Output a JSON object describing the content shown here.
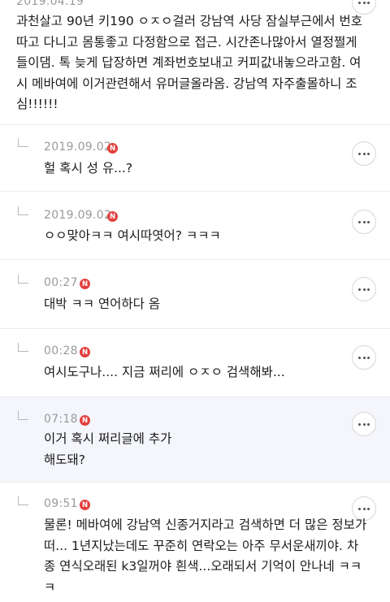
{
  "post": {
    "date": "2019.04.19",
    "text": "과천살고 90년 키190 ㅇㅈㅇ걸러 강남역 사당 잠실부근에서 번호따고 다니고 몸통좋고 다정함으로 접근. 시간존나많아서 열정쩔게 들이댐. 톡 늦게 답장하면 계좌번호보내고 커피값내놓으라고함. 여시 메바여에 이거관련해서 유머글올라옴. 강남역 자주출몰하니 조심!!!!!!"
  },
  "comments": [
    {
      "date": "2019.09.02",
      "badge": "N",
      "text": "헐 혹시 성 유...?"
    },
    {
      "date": "2019.09.02",
      "badge": "N",
      "text": "ㅇㅇ맞아ㅋㅋ 여시따엿어? ㅋㅋㅋ"
    },
    {
      "date": "00:27",
      "badge": "N",
      "text": "대박 ㅋㅋ 연어하다 옴"
    },
    {
      "date": "00:28",
      "badge": "N",
      "text": "여시도구나.... 지금 쩌리에 ㅇㅈㅇ 검색해봐..."
    },
    {
      "date": "07:18",
      "badge": "N",
      "text": "이거 혹시 쩌리글에 추가해도돼?"
    },
    {
      "date": "09:51",
      "badge": "N",
      "text": "물론! 메바여에 강남역 신종거지라고 검색하면 더 많은 정보가 떠...  1년지났는데도 꾸준히 연락오는 아주 무서운새끼야. 차종 연식오래된 k3일꺼야 흰색...오래되서 기억이 안나네 ㅋㅋㅋ"
    }
  ],
  "icons": {
    "reply": "reply-arrow-icon",
    "new": "new-badge-icon",
    "more": "more-options-icon"
  },
  "colors": {
    "badge": "#e2403f",
    "highlight": "#f4f6fb",
    "meta": "#9a9a9a"
  }
}
